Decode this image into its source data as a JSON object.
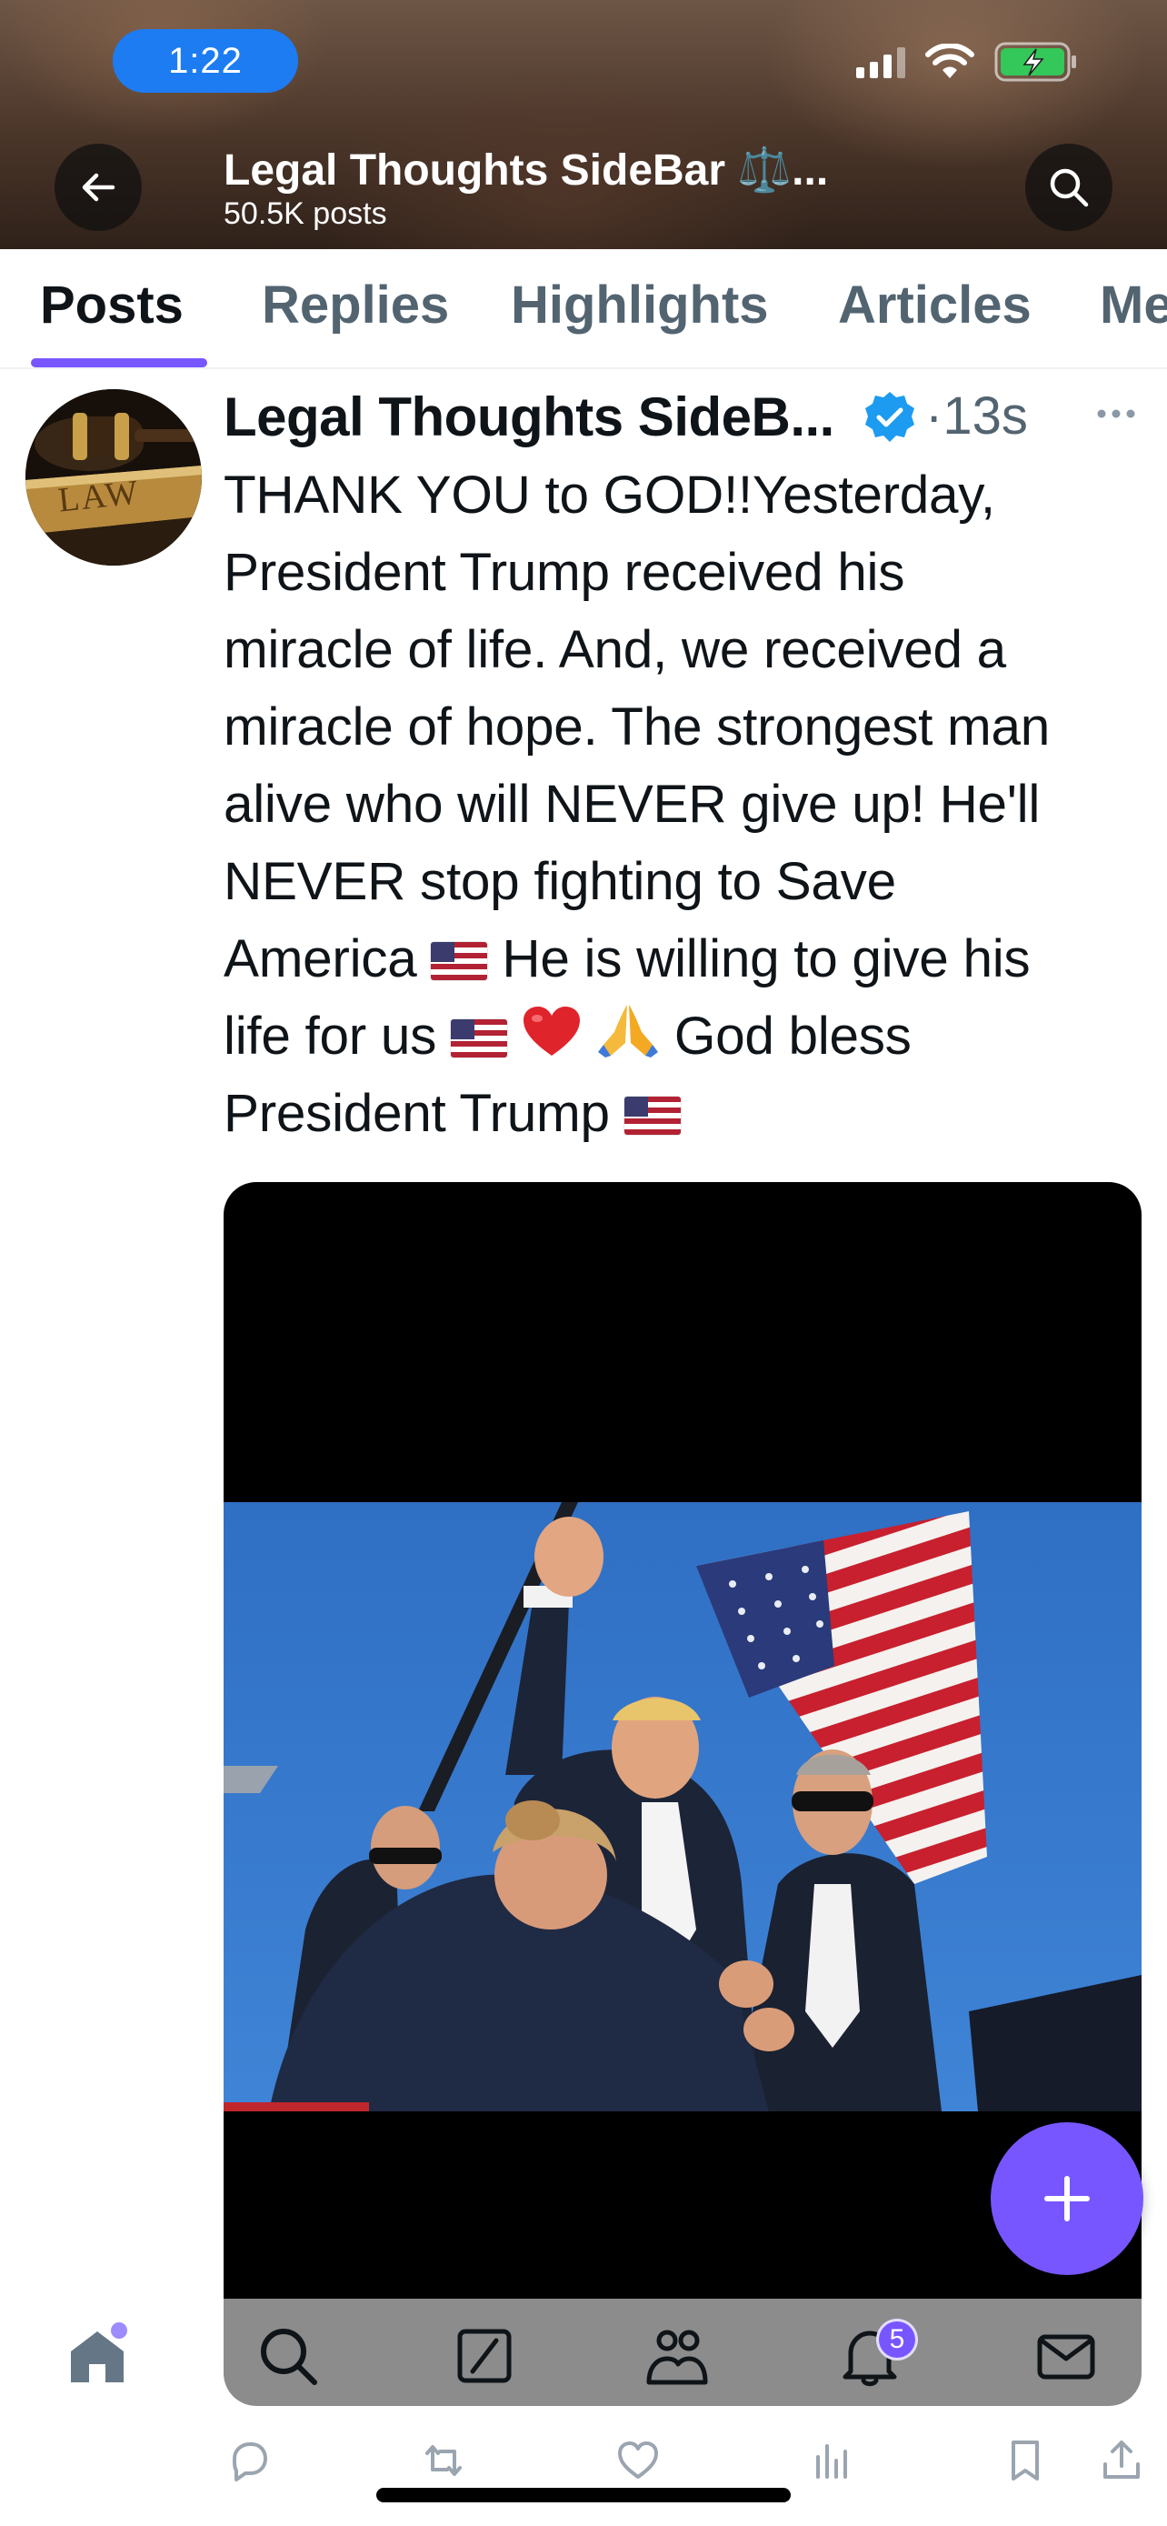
{
  "status_bar": {
    "time": "1:22"
  },
  "header": {
    "title": "Legal Thoughts SideBar ⚖️...",
    "post_count": "50.5K posts"
  },
  "tabs": [
    {
      "label": "Posts",
      "active": true
    },
    {
      "label": "Replies",
      "active": false
    },
    {
      "label": "Highlights",
      "active": false
    },
    {
      "label": "Articles",
      "active": false
    },
    {
      "label": "Me",
      "active": false
    }
  ],
  "post": {
    "author_name": "Legal Thoughts SideB...",
    "avatar_text": "LAW",
    "timestamp": "·13s",
    "text_lines": [
      "THANK YOU to GOD!!Yesterday,",
      "President Trump received his",
      "miracle of life. And, we received a",
      "miracle of hope. The strongest man",
      "alive who will NEVER give up! He'll",
      "NEVER stop fighting to Save"
    ],
    "line7_a": "America",
    "line7_b": "He is willing to give his",
    "line8_a": "life for us",
    "line8_b": "God bless",
    "line9_a": "President Trump"
  },
  "bottom_nav": {
    "notification_count": "5"
  },
  "colors": {
    "accent": "#7856ff",
    "verified": "#1d9bf0",
    "status_time_pill": "#1d7cf2",
    "secondary_text": "#536471"
  },
  "icons": {
    "header": [
      "back-arrow-icon",
      "search-icon"
    ],
    "nav": [
      "home-icon",
      "search-icon",
      "grok-icon",
      "communities-icon",
      "notifications-icon",
      "messages-icon"
    ],
    "actions": [
      "reply-icon",
      "repost-icon",
      "like-icon",
      "views-icon",
      "bookmark-icon",
      "share-icon"
    ],
    "fab": "plus-icon"
  }
}
